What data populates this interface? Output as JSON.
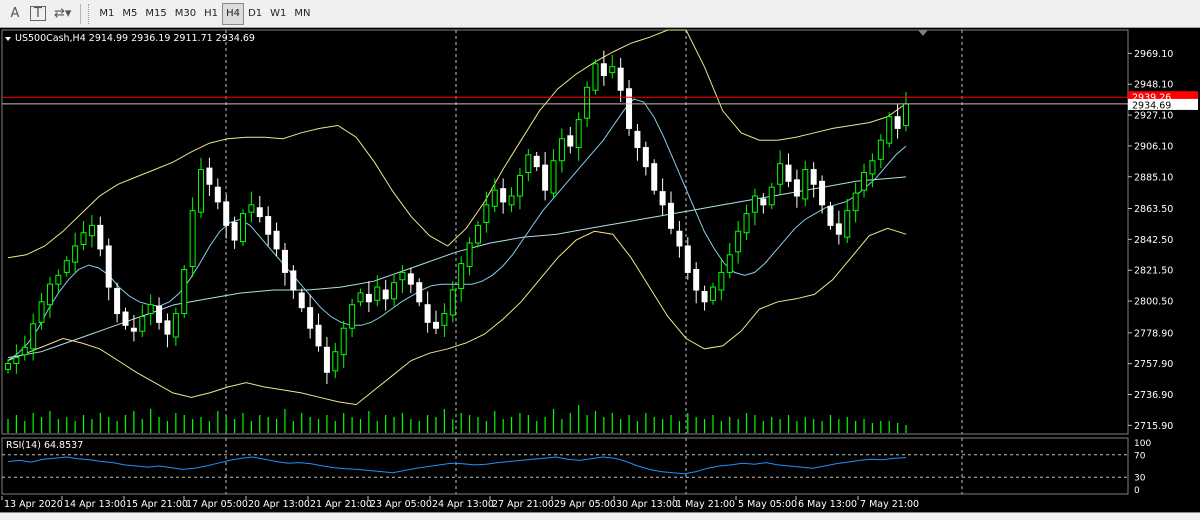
{
  "toolbar": {
    "tools": [
      {
        "name": "text-tool-icon",
        "glyph": "A"
      },
      {
        "name": "text-label-tool-icon",
        "glyph": "T"
      },
      {
        "name": "shapes-tool-icon",
        "glyph": "⇄▾"
      }
    ],
    "timeframes": [
      "M1",
      "M5",
      "M15",
      "M30",
      "H1",
      "H4",
      "D1",
      "W1",
      "MN"
    ],
    "active_timeframe": "H4"
  },
  "chart": {
    "header": "US500Cash,H4  2914.99 2936.19 2911.71 2934.69",
    "bid_price_tag": "2939.26",
    "current_price_tag": "2934.69",
    "rsi_label": "RSI(14) 64.8537",
    "colors": {
      "bull": "#00ff00",
      "bear": "#ffffff",
      "bollinger": "#f0e68c",
      "ma_fast": "#87ceeb",
      "ma_slow": "#b0e0e6",
      "rsi": "#1e90ff",
      "price_line": "#ff0000",
      "grid": "#c0c0c0"
    }
  },
  "chart_data": {
    "type": "candlestick",
    "symbol": "US500Cash",
    "timeframe": "H4",
    "ohlc_header": {
      "open": 2914.99,
      "high": 2936.19,
      "low": 2911.71,
      "close": 2934.69
    },
    "ylim": [
      2710,
      2985
    ],
    "y_ticks": [
      "2969.10",
      "2948.10",
      "2927.10",
      "2906.10",
      "2885.10",
      "2863.50",
      "2842.50",
      "2821.50",
      "2800.50",
      "2778.90",
      "2757.90",
      "2736.90",
      "2715.90"
    ],
    "y_tick_values": [
      2969.1,
      2948.1,
      2927.1,
      2906.1,
      2885.1,
      2863.5,
      2842.5,
      2821.5,
      2800.5,
      2778.9,
      2757.9,
      2736.9,
      2715.9
    ],
    "x_labels": [
      "13 Apr 2020",
      "14 Apr 13:00",
      "15 Apr 21:00",
      "17 Apr 05:00",
      "20 Apr 13:00",
      "21 Apr 21:00",
      "23 Apr 05:00",
      "24 Apr 13:00",
      "27 Apr 21:00",
      "29 Apr 05:00",
      "30 Apr 13:00",
      "1 May 21:00",
      "5 May 05:00",
      "6 May 13:00",
      "7 May 21:00"
    ],
    "closes": [
      2758,
      2762,
      2769,
      2785,
      2800,
      2812,
      2818,
      2828,
      2838,
      2847,
      2852,
      2836,
      2810,
      2792,
      2784,
      2780,
      2790,
      2798,
      2786,
      2778,
      2792,
      2822,
      2862,
      2890,
      2880,
      2868,
      2852,
      2842,
      2860,
      2866,
      2858,
      2846,
      2836,
      2820,
      2808,
      2796,
      2782,
      2770,
      2752,
      2766,
      2782,
      2798,
      2806,
      2800,
      2810,
      2802,
      2813,
      2820,
      2812,
      2800,
      2786,
      2782,
      2792,
      2808,
      2826,
      2840,
      2852,
      2866,
      2876,
      2868,
      2872,
      2886,
      2900,
      2892,
      2876,
      2896,
      2911,
      2906,
      2924,
      2946,
      2962,
      2954,
      2960,
      2944,
      2918,
      2905,
      2892,
      2876,
      2866,
      2850,
      2838,
      2820,
      2808,
      2800,
      2810,
      2820,
      2832,
      2848,
      2860,
      2872,
      2866,
      2878,
      2894,
      2882,
      2872,
      2890,
      2880,
      2866,
      2852,
      2846,
      2862,
      2874,
      2888,
      2896,
      2910,
      2926,
      2918,
      2934.69
    ],
    "sma_fast": [
      2760,
      2765,
      2772,
      2782,
      2795,
      2806,
      2815,
      2822,
      2825,
      2823,
      2818,
      2810,
      2804,
      2800,
      2798,
      2797,
      2800,
      2806,
      2815,
      2826,
      2838,
      2848,
      2854,
      2856,
      2852,
      2844,
      2836,
      2828,
      2820,
      2812,
      2804,
      2796,
      2790,
      2786,
      2784,
      2784,
      2786,
      2790,
      2795,
      2800,
      2804,
      2808,
      2811,
      2812,
      2812,
      2812,
      2812,
      2814,
      2818,
      2824,
      2832,
      2842,
      2852,
      2862,
      2870,
      2878,
      2886,
      2894,
      2902,
      2910,
      2920,
      2930,
      2938,
      2936,
      2926,
      2912,
      2896,
      2880,
      2864,
      2848,
      2836,
      2826,
      2820,
      2818,
      2820,
      2826,
      2834,
      2842,
      2850,
      2856,
      2860,
      2864,
      2866,
      2868,
      2872,
      2878,
      2884,
      2892,
      2900,
      2906
    ],
    "sma_slow": [
      2762,
      2764,
      2766,
      2770,
      2774,
      2778,
      2782,
      2786,
      2790,
      2794,
      2798,
      2800,
      2802,
      2804,
      2806,
      2807,
      2808,
      2808,
      2808,
      2809,
      2810,
      2812,
      2814,
      2818,
      2822,
      2826,
      2830,
      2834,
      2837,
      2840,
      2842,
      2844,
      2845,
      2846,
      2848,
      2850,
      2852,
      2854,
      2856,
      2858,
      2860,
      2862,
      2864,
      2866,
      2868,
      2870,
      2872,
      2874,
      2876,
      2878,
      2880,
      2882,
      2883,
      2884,
      2885
    ],
    "bb_upper": [
      2830,
      2832,
      2838,
      2848,
      2860,
      2872,
      2880,
      2885,
      2890,
      2895,
      2902,
      2908,
      2911,
      2912,
      2912,
      2911,
      2915,
      2918,
      2920,
      2912,
      2895,
      2875,
      2858,
      2845,
      2838,
      2850,
      2868,
      2890,
      2910,
      2930,
      2945,
      2955,
      2963,
      2970,
      2976,
      2980,
      2985,
      2985,
      2960,
      2930,
      2915,
      2910,
      2910,
      2912,
      2915,
      2918,
      2920,
      2922,
      2926,
      2935
    ],
    "bb_lower": [
      2760,
      2765,
      2770,
      2775,
      2772,
      2768,
      2760,
      2752,
      2745,
      2738,
      2735,
      2738,
      2742,
      2745,
      2742,
      2740,
      2738,
      2735,
      2732,
      2730,
      2740,
      2750,
      2760,
      2765,
      2768,
      2772,
      2778,
      2788,
      2800,
      2815,
      2830,
      2842,
      2848,
      2846,
      2830,
      2810,
      2790,
      2775,
      2768,
      2770,
      2780,
      2795,
      2800,
      2802,
      2805,
      2815,
      2830,
      2845,
      2850,
      2846
    ],
    "volumes": [
      0.35,
      0.45,
      0.3,
      0.5,
      0.4,
      0.55,
      0.35,
      0.4,
      0.3,
      0.45,
      0.35,
      0.5,
      0.4,
      0.3,
      0.45,
      0.55,
      0.35,
      0.6,
      0.4,
      0.3,
      0.5,
      0.45,
      0.35,
      0.4,
      0.3,
      0.55,
      0.4,
      0.35,
      0.5,
      0.3,
      0.45,
      0.4,
      0.35,
      0.6,
      0.3,
      0.5,
      0.4,
      0.35,
      0.45,
      0.3,
      0.5,
      0.4,
      0.35,
      0.55,
      0.3,
      0.45,
      0.4,
      0.5,
      0.35,
      0.3,
      0.45,
      0.4,
      0.6,
      0.35,
      0.5,
      0.45,
      0.4,
      0.3,
      0.55,
      0.35,
      0.4,
      0.5,
      0.45,
      0.3,
      0.4,
      0.6,
      0.35,
      0.5,
      0.7,
      0.45,
      0.55,
      0.4,
      0.5,
      0.35,
      0.45,
      0.3,
      0.5,
      0.4,
      0.35,
      0.45,
      0.3,
      0.5,
      0.4,
      0.35,
      0.45,
      0.3,
      0.4,
      0.35,
      0.5,
      0.45,
      0.3,
      0.4,
      0.35,
      0.45,
      0.3,
      0.4,
      0.35,
      0.3,
      0.45,
      0.35,
      0.4,
      0.3,
      0.35,
      0.25,
      0.3,
      0.3,
      0.25,
      0.2
    ],
    "rsi": {
      "label": "RSI(14) 64.8537",
      "levels": [
        "100",
        "70",
        "30",
        "0"
      ],
      "level_values": [
        100,
        70,
        30,
        0
      ],
      "value": 64.8537,
      "values": [
        58,
        60,
        57,
        62,
        64,
        66,
        63,
        61,
        58,
        56,
        52,
        50,
        48,
        50,
        47,
        44,
        46,
        50,
        55,
        60,
        64,
        66,
        62,
        58,
        55,
        56,
        54,
        50,
        47,
        45,
        44,
        42,
        40,
        38,
        42,
        46,
        49,
        52,
        55,
        54,
        52,
        53,
        56,
        58,
        60,
        62,
        64,
        66,
        62,
        60,
        63,
        66,
        64,
        58,
        50,
        44,
        40,
        38,
        36,
        40,
        46,
        50,
        52,
        55,
        53,
        56,
        52,
        50,
        48,
        46,
        50,
        54,
        57,
        60,
        62,
        61,
        64,
        65
      ]
    }
  }
}
